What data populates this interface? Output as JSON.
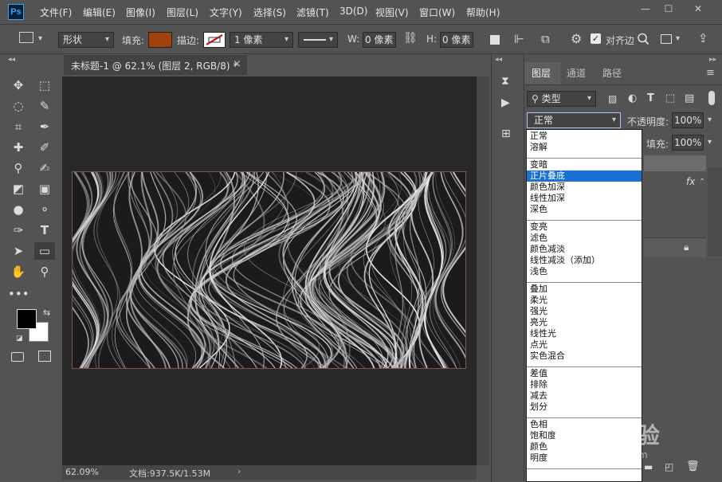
{
  "app": {
    "logo": "Ps"
  },
  "menubar": {
    "items": [
      "文件(F)",
      "编辑(E)",
      "图像(I)",
      "图层(L)",
      "文字(Y)",
      "选择(S)",
      "滤镜(T)",
      "3D(D)",
      "视图(V)",
      "窗口(W)",
      "帮助(H)"
    ],
    "window_controls": {
      "minimize": "—",
      "maximize": "☐",
      "close": "✕"
    }
  },
  "options_bar": {
    "shape_mode": "形状",
    "fill_label": "填充:",
    "fill_color": "#a0400a",
    "stroke_label": "描边:",
    "stroke_width": "1 像素",
    "w_label": "W:",
    "w_value": "0 像素",
    "h_label": "H:",
    "h_value": "0 像素",
    "align_edges": "对齐边"
  },
  "document": {
    "tab_title": "未标题-1 @ 62.1% (图层 2, RGB/8) *",
    "tab_close": "×",
    "status_zoom": "62.09%",
    "status_doc": "文档:937.5K/1.53M"
  },
  "layers_panel": {
    "tabs": [
      "图层",
      "通道",
      "路径"
    ],
    "filter_kind": "类型",
    "blend_mode": "正常",
    "opacity_label": "不透明度:",
    "opacity_value": "100%",
    "fill_label": "填充:",
    "fill_value": "100%",
    "fx_label": "fx"
  },
  "blend_groups": [
    [
      "正常",
      "溶解"
    ],
    [
      "变暗",
      "正片叠底",
      "颜色加深",
      "线性加深",
      "深色"
    ],
    [
      "变亮",
      "滤色",
      "颜色减淡",
      "线性减淡（添加）",
      "浅色"
    ],
    [
      "叠加",
      "柔光",
      "强光",
      "亮光",
      "线性光",
      "点光",
      "实色混合"
    ],
    [
      "差值",
      "排除",
      "减去",
      "划分"
    ],
    [
      "色相",
      "饱和度",
      "颜色",
      "明度"
    ]
  ],
  "blend_selected": "正片叠底",
  "colors": {
    "foreground": "#000000",
    "background": "#ffffff",
    "accent": "#1a6fd1"
  },
  "watermark": {
    "brand": "Baidu经验",
    "url": "jingyan.baidu.com"
  }
}
